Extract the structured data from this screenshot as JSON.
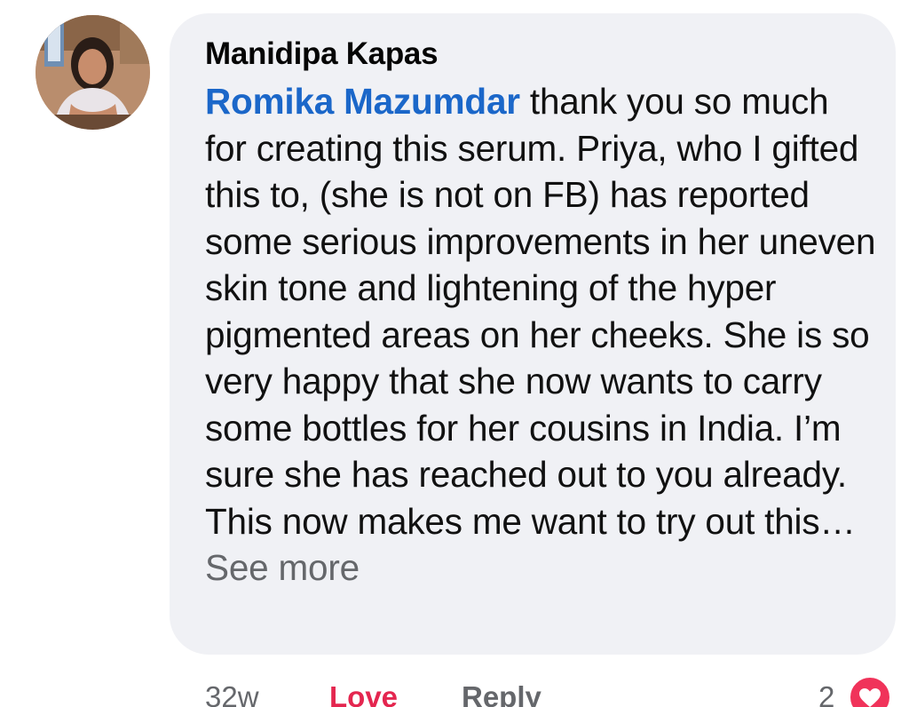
{
  "comment": {
    "author": "Manidipa Kapas",
    "mention": "Romika Mazumdar",
    "body": " thank you so much for creating this serum. Priya, who I gifted this to, (she is not on FB) has reported some serious improvements in her uneven skin tone and lightening of the hyper pigmented areas on her cheeks. She is so very happy that she now wants to carry some bottles for her cousins in India. I’m sure she has reached out to you already. This now makes me want to try out this… ",
    "see_more": "See more",
    "avatar_icon": "profile-photo"
  },
  "actions": {
    "time": "32w",
    "love_label": "Love",
    "reply_label": "Reply",
    "reaction_count": "2",
    "reaction_icon": "heart-icon"
  },
  "colors": {
    "bubble": "#f0f1f5",
    "mention": "#1b67c9",
    "love": "#e4264f",
    "muted": "#65676b",
    "heart": "#f0335a"
  }
}
